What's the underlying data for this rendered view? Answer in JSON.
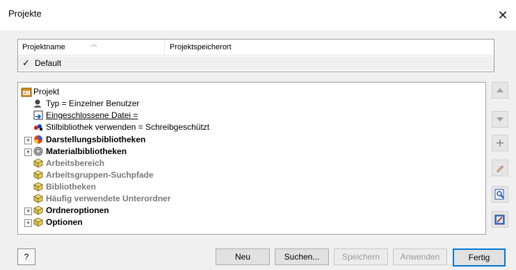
{
  "window": {
    "title": "Projekte",
    "close_glyph": "✕"
  },
  "projects": {
    "columns": [
      "Projektname",
      "Projektspeicherort"
    ],
    "rows": [
      {
        "check": "✓",
        "name": "Default",
        "location": ""
      }
    ]
  },
  "tree": {
    "root": "Projekt",
    "items": [
      {
        "label": "Typ = Einzelner Benutzer"
      },
      {
        "label": "Eingeschlossene Datei ="
      },
      {
        "label": "Stilbibliothek verwenden = Schreibgeschützt"
      },
      {
        "label": "Darstellungsbibliotheken"
      },
      {
        "label": "Materialbibliotheken"
      },
      {
        "label": "Arbeitsbereich"
      },
      {
        "label": "Arbeitsgruppen-Suchpfade"
      },
      {
        "label": "Bibliotheken"
      },
      {
        "label": "Häufig verwendete Unterordner"
      },
      {
        "label": "Ordneroptionen"
      },
      {
        "label": "Optionen"
      }
    ]
  },
  "buttons": {
    "help": "?",
    "new": "Neu",
    "search": "Suchen...",
    "save": "Speichern",
    "apply": "Anwenden",
    "done": "Fertig"
  }
}
